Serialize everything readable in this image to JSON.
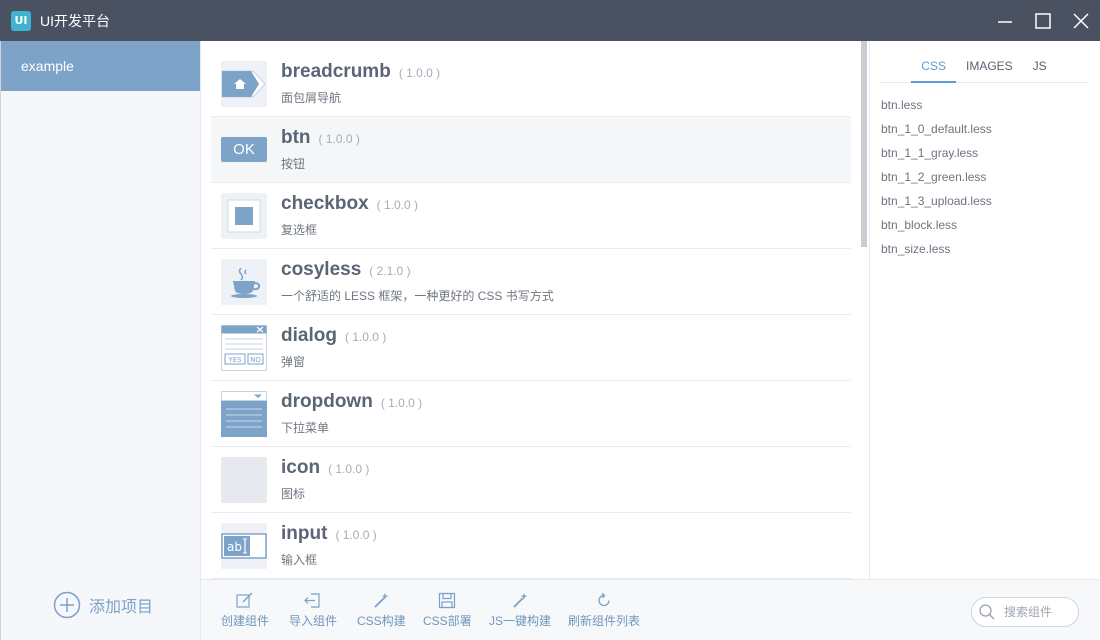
{
  "window": {
    "logo_text": "UI",
    "title": "UI开发平台"
  },
  "sidebar": {
    "projects": [
      {
        "label": "example"
      }
    ],
    "add_project_label": "添加项目"
  },
  "components": [
    {
      "name": "breadcrumb",
      "version": "( 1.0.0 )",
      "desc": "面包屑导航",
      "icon": "breadcrumb-icon"
    },
    {
      "name": "btn",
      "version": "( 1.0.0 )",
      "desc": "按钮",
      "icon": "ok-button-icon",
      "icon_text": "OK"
    },
    {
      "name": "checkbox",
      "version": "( 1.0.0 )",
      "desc": "复选框",
      "icon": "checkbox-icon"
    },
    {
      "name": "cosyless",
      "version": "( 2.1.0 )",
      "desc": "一个舒适的 LESS 框架，一种更好的 CSS 书写方式",
      "icon": "coffee-cup-icon"
    },
    {
      "name": "dialog",
      "version": "( 1.0.0 )",
      "desc": "弹窗",
      "icon": "dialog-icon",
      "icon_yes": "YES",
      "icon_no": "NO"
    },
    {
      "name": "dropdown",
      "version": "( 1.0.0 )",
      "desc": "下拉菜单",
      "icon": "dropdown-icon"
    },
    {
      "name": "icon",
      "version": "( 1.0.0 )",
      "desc": "图标",
      "icon": "blank-icon"
    },
    {
      "name": "input",
      "version": "( 1.0.0 )",
      "desc": "输入框",
      "icon": "input-icon",
      "icon_text": "ab"
    }
  ],
  "right_panel": {
    "tabs": [
      {
        "label": "CSS",
        "active": true
      },
      {
        "label": "IMAGES",
        "active": false
      },
      {
        "label": "JS",
        "active": false
      }
    ],
    "files": [
      "btn.less",
      "btn_1_0_default.less",
      "btn_1_1_gray.less",
      "btn_1_2_green.less",
      "btn_1_3_upload.less",
      "btn_block.less",
      "btn_size.less"
    ]
  },
  "toolbar": {
    "buttons": [
      {
        "label": "创建组件",
        "icon": "edit-icon"
      },
      {
        "label": "导入组件",
        "icon": "import-icon"
      },
      {
        "label": "CSS构建",
        "icon": "magic-wand-icon"
      },
      {
        "label": "CSS部署",
        "icon": "save-icon"
      },
      {
        "label": "JS一键构建",
        "icon": "magic-wand-icon"
      },
      {
        "label": "刷新组件列表",
        "icon": "refresh-icon"
      }
    ],
    "search_placeholder": "搜索组件"
  },
  "colors": {
    "titlebar": "#4a5261",
    "accent": "#5a9bd5",
    "selected_project": "#7ea3c9",
    "icon_blue": "#7ea3c9"
  }
}
